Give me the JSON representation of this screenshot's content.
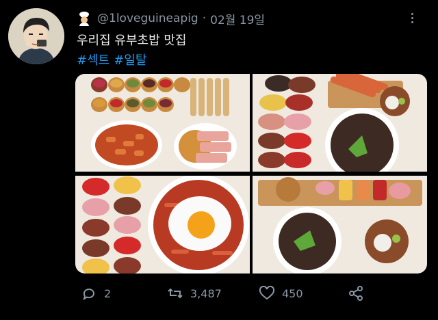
{
  "tweet": {
    "handle": "@1loveguineapig",
    "separator": "·",
    "date": "02월 19일",
    "text": "우리집 유부초밥 맛집",
    "hashtags": [
      "#섹트",
      "#일탈"
    ]
  },
  "actions": {
    "replies": "2",
    "retweets": "3,487",
    "likes": "450"
  },
  "media": {
    "count": 4,
    "descriptions": []
  },
  "colors": {
    "background": "#000000",
    "text": "#e7e9ea",
    "muted": "#8b98a5",
    "link": "#1d9bf0"
  }
}
